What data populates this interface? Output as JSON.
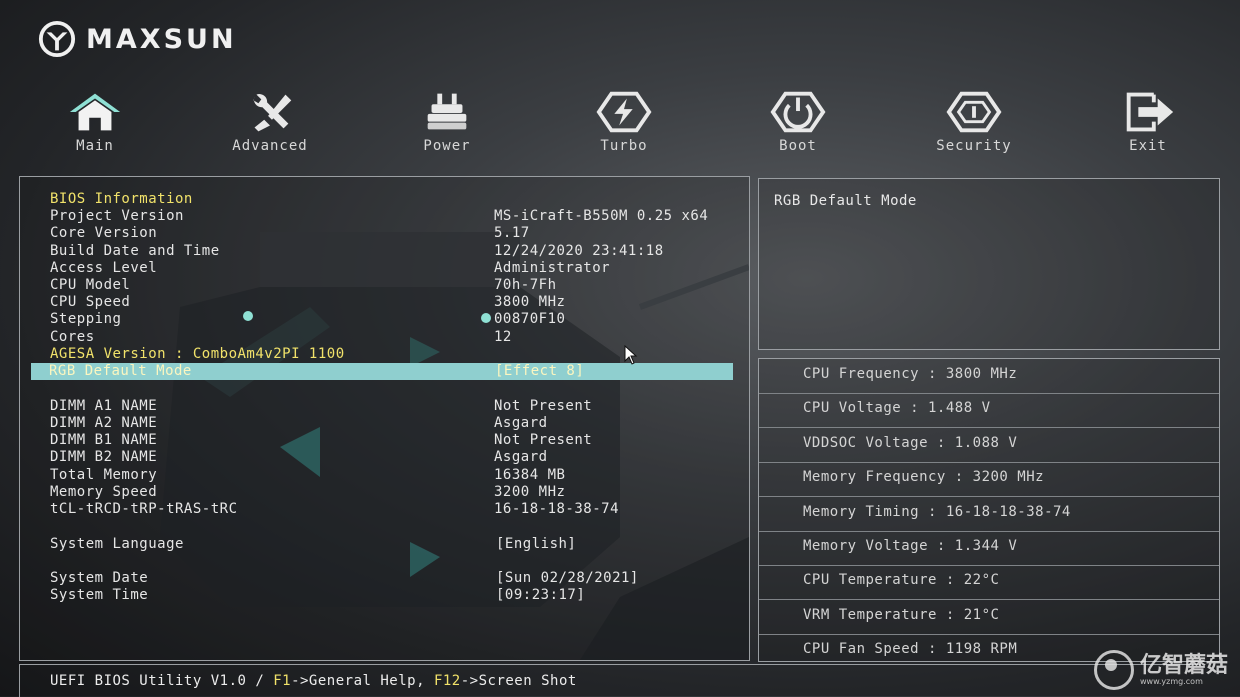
{
  "brand": {
    "logo_text": "MAXSUN"
  },
  "nav": [
    {
      "label": "Main",
      "icon": "home-icon"
    },
    {
      "label": "Advanced",
      "icon": "tools-icon"
    },
    {
      "label": "Power",
      "icon": "chip-icon"
    },
    {
      "label": "Turbo",
      "icon": "lightning-icon"
    },
    {
      "label": "Boot",
      "icon": "power-icon"
    },
    {
      "label": "Security",
      "icon": "shield-icon"
    },
    {
      "label": "Exit",
      "icon": "exit-icon"
    }
  ],
  "main": {
    "rows": [
      {
        "label": "BIOS Information",
        "value": "",
        "style": "heading"
      },
      {
        "label": "Project Version",
        "value": "MS-iCraft-B550M 0.25 x64"
      },
      {
        "label": "Core Version",
        "value": "5.17"
      },
      {
        "label": "Build Date and Time",
        "value": "12/24/2020 23:41:18"
      },
      {
        "label": "Access Level",
        "value": "Administrator"
      },
      {
        "label": "CPU Model",
        "value": "70h-7Fh"
      },
      {
        "label": "CPU Speed",
        "value": "3800 MHz"
      },
      {
        "label": "Stepping",
        "value": "00870F10"
      },
      {
        "label": "Cores",
        "value": "12"
      },
      {
        "label": "AGESA Version : ComboAm4v2PI 1100",
        "value": "",
        "style": "heading"
      },
      {
        "label": "RGB Default Mode",
        "value": "[Effect 8]",
        "style": "selected"
      },
      {
        "label": "DIMM A1 NAME",
        "value": "Not Present"
      },
      {
        "label": "DIMM A2 NAME",
        "value": "Asgard"
      },
      {
        "label": "DIMM B1 NAME",
        "value": "Not Present"
      },
      {
        "label": "DIMM B2 NAME",
        "value": "Asgard"
      },
      {
        "label": "Total Memory",
        "value": "16384 MB"
      },
      {
        "label": "Memory Speed",
        "value": "3200 MHz"
      },
      {
        "label": "tCL-tRCD-tRP-tRAS-tRC",
        "value": "16-18-18-38-74"
      },
      {
        "label": "System Language",
        "value": "[English]"
      },
      {
        "label": "System Date",
        "value": "[Sun 02/28/2021]"
      },
      {
        "label": "System Time",
        "value": "[09:23:17]"
      }
    ]
  },
  "help": {
    "title": "RGB Default Mode"
  },
  "status": [
    "CPU Frequency : 3800 MHz",
    "CPU Voltage : 1.488 V",
    "VDDSOC Voltage : 1.088 V",
    "Memory Frequency : 3200 MHz",
    "Memory Timing : 16-18-18-38-74",
    "Memory Voltage : 1.344 V",
    "CPU Temperature : 22°C",
    "VRM Temperature : 21°C",
    "CPU Fan Speed : 1198 RPM"
  ],
  "footer": {
    "prefix": "UEFI BIOS Utility V1.0 / ",
    "key1": "F1",
    "text1": "->General Help, ",
    "key2": "F12",
    "text2": "->Screen Shot"
  },
  "watermark": {
    "text": "亿智蘑菇",
    "url": "www.yzmg.com"
  },
  "colors": {
    "accent_yellow": "#f1e26a",
    "highlight": "#8fcfcf",
    "border": "#9a9ea2"
  }
}
